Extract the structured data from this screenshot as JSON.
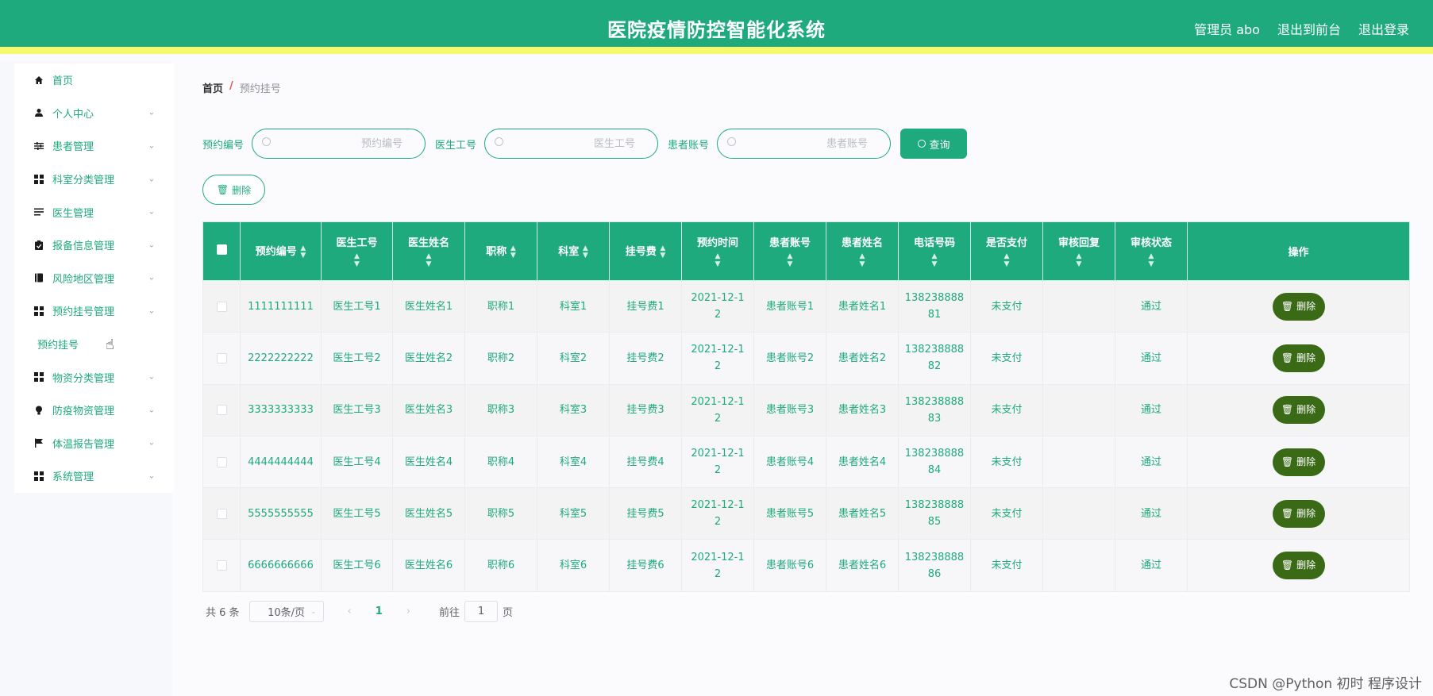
{
  "header": {
    "title": "医院疫情防控智能化系统",
    "admin_label": "管理员 abo",
    "front_link": "退出到前台",
    "logout_link": "退出登录"
  },
  "sidebar": {
    "items": [
      {
        "label": "首页",
        "icon": "home-icon"
      },
      {
        "label": "个人中心",
        "icon": "user-icon"
      },
      {
        "label": "患者管理",
        "icon": "sliders-icon"
      },
      {
        "label": "科室分类管理",
        "icon": "grid-icon"
      },
      {
        "label": "医生管理",
        "icon": "list-icon"
      },
      {
        "label": "报备信息管理",
        "icon": "clipboard-icon"
      },
      {
        "label": "风险地区管理",
        "icon": "book-icon"
      },
      {
        "label": "预约挂号管理",
        "icon": "grid-icon"
      },
      {
        "label": "预约挂号",
        "icon": ""
      },
      {
        "label": "物资分类管理",
        "icon": "grid-icon"
      },
      {
        "label": "防疫物资管理",
        "icon": "bulb-icon"
      },
      {
        "label": "体温报告管理",
        "icon": "flag-icon"
      },
      {
        "label": "系统管理",
        "icon": "grid-icon"
      }
    ]
  },
  "breadcrumb": {
    "home": "首页",
    "separator": "/",
    "current": "预约挂号"
  },
  "search": {
    "label1": "预约编号",
    "placeholder1": "预约编号",
    "label2": "医生工号",
    "placeholder2": "医生工号",
    "label3": "患者账号",
    "placeholder3": "患者账号",
    "query_label": "查询"
  },
  "actions": {
    "delete_label": "删除"
  },
  "table": {
    "headers": [
      "预约编号",
      "医生工号",
      "医生姓名",
      "职称",
      "科室",
      "挂号费",
      "预约时间",
      "患者账号",
      "患者姓名",
      "电话号码",
      "是否支付",
      "审核回复",
      "审核状态",
      "操作"
    ],
    "rows": [
      {
        "id": "1111111111",
        "doc_no": "医生工号1",
        "doc_name": "医生姓名1",
        "title": "职称1",
        "dept": "科室1",
        "fee": "挂号费1",
        "time_a": "2021-12-1",
        "time_b": "2",
        "acct": "患者账号1",
        "pname": "患者姓名1",
        "phone_a": "138238888",
        "phone_b": "81",
        "paid": "未支付",
        "reply": "",
        "status": "通过",
        "del": "删除"
      },
      {
        "id": "2222222222",
        "doc_no": "医生工号2",
        "doc_name": "医生姓名2",
        "title": "职称2",
        "dept": "科室2",
        "fee": "挂号费2",
        "time_a": "2021-12-1",
        "time_b": "2",
        "acct": "患者账号2",
        "pname": "患者姓名2",
        "phone_a": "138238888",
        "phone_b": "82",
        "paid": "未支付",
        "reply": "",
        "status": "通过",
        "del": "删除"
      },
      {
        "id": "3333333333",
        "doc_no": "医生工号3",
        "doc_name": "医生姓名3",
        "title": "职称3",
        "dept": "科室3",
        "fee": "挂号费3",
        "time_a": "2021-12-1",
        "time_b": "2",
        "acct": "患者账号3",
        "pname": "患者姓名3",
        "phone_a": "138238888",
        "phone_b": "83",
        "paid": "未支付",
        "reply": "",
        "status": "通过",
        "del": "删除"
      },
      {
        "id": "4444444444",
        "doc_no": "医生工号4",
        "doc_name": "医生姓名4",
        "title": "职称4",
        "dept": "科室4",
        "fee": "挂号费4",
        "time_a": "2021-12-1",
        "time_b": "2",
        "acct": "患者账号4",
        "pname": "患者姓名4",
        "phone_a": "138238888",
        "phone_b": "84",
        "paid": "未支付",
        "reply": "",
        "status": "通过",
        "del": "删除"
      },
      {
        "id": "5555555555",
        "doc_no": "医生工号5",
        "doc_name": "医生姓名5",
        "title": "职称5",
        "dept": "科室5",
        "fee": "挂号费5",
        "time_a": "2021-12-1",
        "time_b": "2",
        "acct": "患者账号5",
        "pname": "患者姓名5",
        "phone_a": "138238888",
        "phone_b": "85",
        "paid": "未支付",
        "reply": "",
        "status": "通过",
        "del": "删除"
      },
      {
        "id": "6666666666",
        "doc_no": "医生工号6",
        "doc_name": "医生姓名6",
        "title": "职称6",
        "dept": "科室6",
        "fee": "挂号费6",
        "time_a": "2021-12-1",
        "time_b": "2",
        "acct": "患者账号6",
        "pname": "患者姓名6",
        "phone_a": "138238888",
        "phone_b": "86",
        "paid": "未支付",
        "reply": "",
        "status": "通过",
        "del": "删除"
      }
    ]
  },
  "pagination": {
    "total": "共 6 条",
    "page_size": "10条/页",
    "current_page": "1",
    "goto_prefix": "前往",
    "goto_value": "1",
    "goto_suffix": "页"
  },
  "watermark": "CSDN @Python 初时 程序设计",
  "colors": {
    "primary": "#1eaa7c",
    "accent_bar": "#f5f96b",
    "row_delete": "#3a6a16"
  }
}
